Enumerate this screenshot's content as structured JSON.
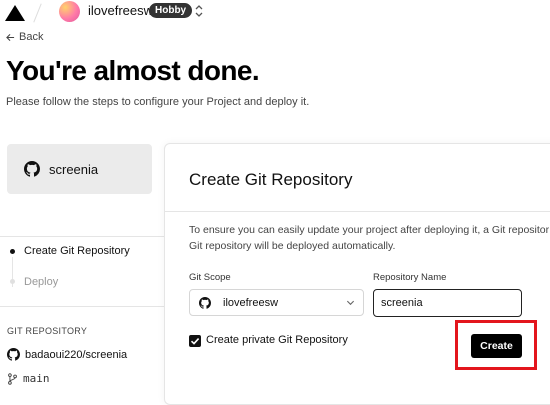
{
  "topbar": {
    "username": "ilovefreesw",
    "plan_badge": "Hobby"
  },
  "nav": {
    "back_label": "Back"
  },
  "header": {
    "title": "You're almost done.",
    "subtitle": "Please follow the steps to configure your Project and deploy it."
  },
  "sidebar": {
    "repo_card_name": "screenia",
    "steps": [
      {
        "label": "Create Git Repository",
        "active": true
      },
      {
        "label": "Deploy",
        "active": false
      }
    ],
    "git_section_heading": "GIT REPOSITORY",
    "repo_link": "badaoui220/screenia",
    "branch": "main"
  },
  "panel": {
    "title": "Create Git Repository",
    "description_line1": "To ensure you can easily update your project after deploying it, a Git repositor",
    "description_line2": "Git repository will be deployed automatically.",
    "git_scope_label": "Git Scope",
    "git_scope_value": "ilovefreesw",
    "repo_name_label": "Repository Name",
    "repo_name_value": "screenia",
    "private_checkbox_label": "Create private Git Repository",
    "private_checked": true,
    "create_button": "Create"
  },
  "colors": {
    "highlight": "#e3161d",
    "primary_button": "#000000",
    "badge": "#333333"
  },
  "icons": [
    "triangle-logo-icon",
    "chevron-updown-icon",
    "arrow-left-icon",
    "github-icon",
    "chevron-down-icon",
    "git-branch-icon",
    "check-icon"
  ]
}
